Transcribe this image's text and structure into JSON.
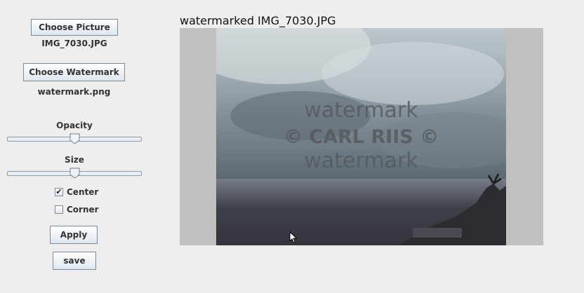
{
  "controls": {
    "choose_picture_label": "Choose Picture",
    "picture_filename": "IMG_7030.JPG",
    "choose_watermark_label": "Choose Watermark",
    "watermark_filename": "watermark.png",
    "opacity_label": "Opacity",
    "opacity_value": 0.5,
    "size_label": "Size",
    "size_value": 0.5,
    "center_label": "Center",
    "center_checked": true,
    "corner_label": "Corner",
    "corner_checked": false,
    "apply_label": "Apply",
    "save_label": "save"
  },
  "preview": {
    "title": "watermarked IMG_7030.JPG",
    "watermark_line1": "watermark",
    "watermark_line2": "© CARL RIIS ©",
    "watermark_line3": "watermark"
  },
  "colors": {
    "window_bg": "#eeeeee",
    "preview_bg": "#c0c0c0",
    "watermark_text": "#55595e"
  },
  "icons": {
    "cursor": "mouse-pointer-icon",
    "check": "checkmark-icon"
  }
}
